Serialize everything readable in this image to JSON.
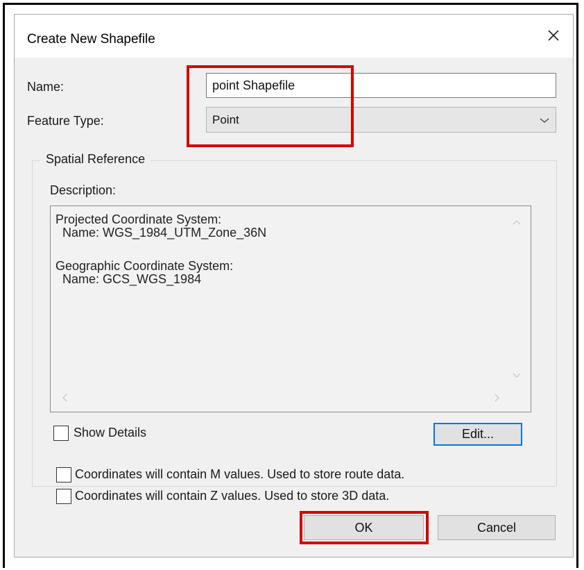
{
  "dialog": {
    "title": "Create New Shapefile",
    "close_icon": "close-icon"
  },
  "form": {
    "name_label": "Name:",
    "name_value": "point Shapefile",
    "feature_type_label": "Feature Type:",
    "feature_type_value": "Point"
  },
  "spatial_reference": {
    "group_label": "Spatial Reference",
    "description_label": "Description:",
    "description_lines": [
      "Projected Coordinate System:",
      "  Name: WGS_1984_UTM_Zone_36N",
      "Geographic Coordinate System:",
      "  Name: GCS_WGS_1984"
    ],
    "show_details_label": "Show Details",
    "show_details_checked": false,
    "edit_button": "Edit..."
  },
  "options": {
    "m_values_label": "Coordinates will contain M values. Used to store route data.",
    "m_values_checked": false,
    "z_values_label": "Coordinates will contain Z values. Used to store 3D data.",
    "z_values_checked": false
  },
  "buttons": {
    "ok": "OK",
    "cancel": "Cancel"
  },
  "colors": {
    "highlight": "#d40000",
    "focus_border": "#0078d7",
    "dialog_bg": "#f0f0f0"
  }
}
